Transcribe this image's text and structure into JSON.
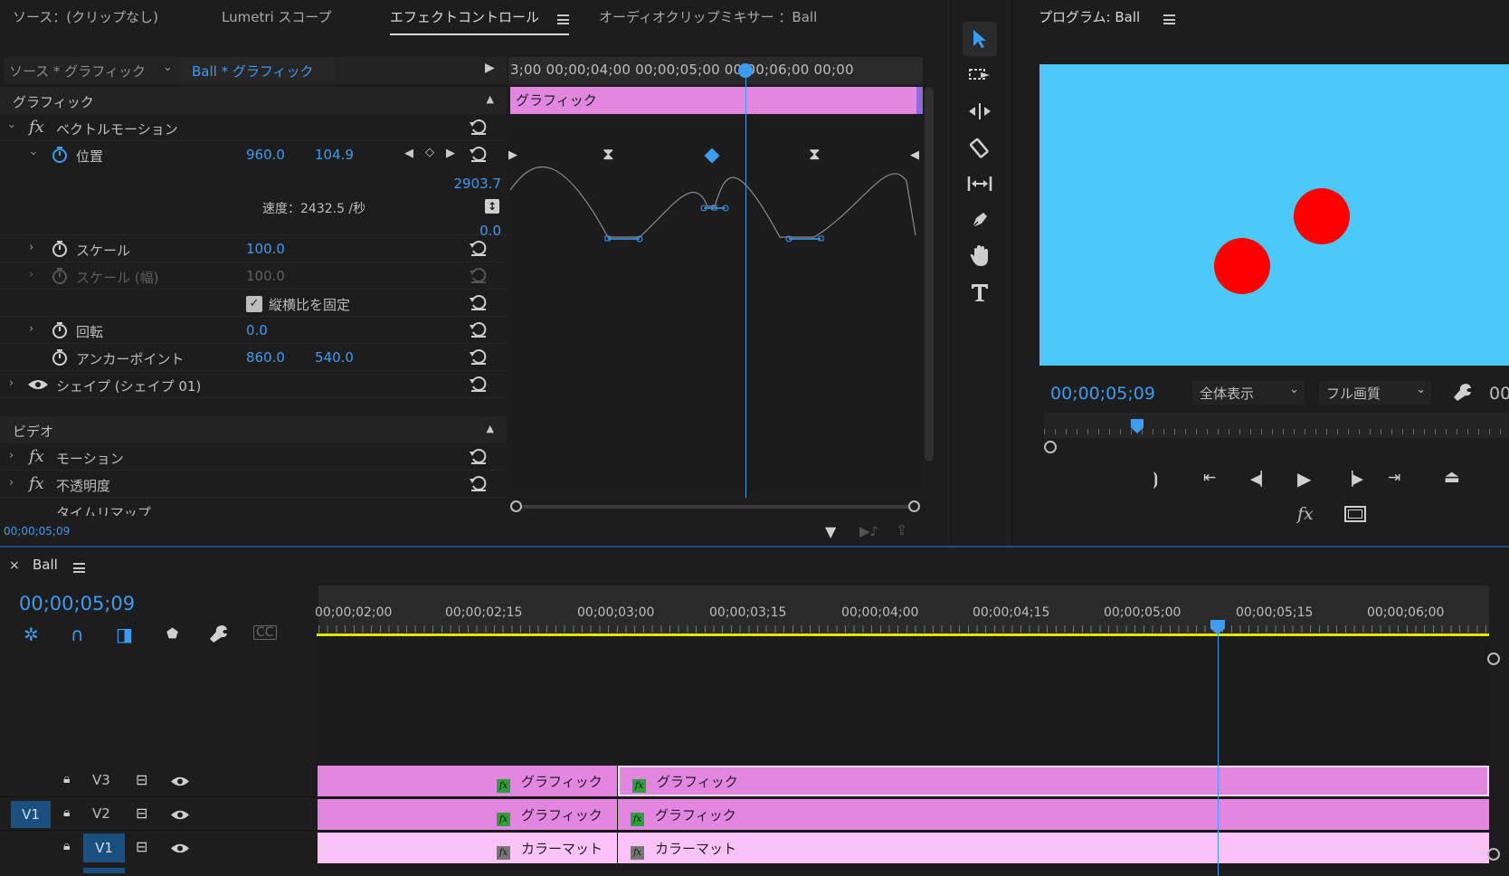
{
  "tabs": [
    {
      "label": "ソース：(クリップなし)"
    },
    {
      "label": "Lumetri スコープ"
    },
    {
      "label": "エフェクトコントロール"
    },
    {
      "label": "オーディオクリップミキサー ：Ball"
    }
  ],
  "effect_controls": {
    "source_label": "ソース * グラフィック",
    "clip_label": "Ball * グラフィック",
    "timecodes": "3;00 00;00;04;00 00;00;05;00 00;00;06;00 00;00",
    "graphic_section": "グラフィック",
    "vector_motion": "ベクトルモーション",
    "position_label": "位置",
    "position_x": "960.0",
    "position_y": "104.9",
    "graph_max": "2903.7",
    "speed_label": "速度：2432.5 /秒",
    "graph_min": "0.0",
    "scale_label": "スケール",
    "scale_value": "100.0",
    "scale_width_label": "スケール (幅)",
    "scale_width_value": "100.0",
    "uniform_scale_label": "縦横比を固定",
    "rotation_label": "回転",
    "rotation_value": "0.0",
    "anchor_label": "アンカーポイント",
    "anchor_x": "860.0",
    "anchor_y": "540.0",
    "shape_label": "シェイプ (シェイプ 01)",
    "video_section": "ビデオ",
    "motion_label": "モーション",
    "opacity_label": "不透明度",
    "time_remap_label": "タイムリマップ",
    "clip_bar_label": "グラフィック",
    "current_time": "00;00;05;09"
  },
  "program": {
    "title": "プログラム: Ball",
    "timecode": "00;00;05;09",
    "zoom_select": "全体表示",
    "quality_select": "フル画質",
    "duration_partial": "00",
    "canvas_color": "#4cc9f8",
    "ball_color": "#ff0000"
  },
  "timeline": {
    "sequence_name": "Ball",
    "timecode": "00;00;05;09",
    "ruler": [
      "00;00;02;00",
      "00;00;02;15",
      "00;00;03;00",
      "00;00;03;15",
      "00;00;04;00",
      "00;00;04;15",
      "00;00;05;00",
      "00;00;05;15",
      "00;00;06;00"
    ],
    "tracks": [
      {
        "name": "V3",
        "clips": [
          "グラフィック",
          "グラフィック"
        ]
      },
      {
        "name": "V2",
        "source_patch": "V1",
        "clips": [
          "グラフィック",
          "グラフィック"
        ]
      },
      {
        "name": "V1",
        "clips": [
          "カラーマット",
          "カラーマット"
        ]
      }
    ]
  }
}
